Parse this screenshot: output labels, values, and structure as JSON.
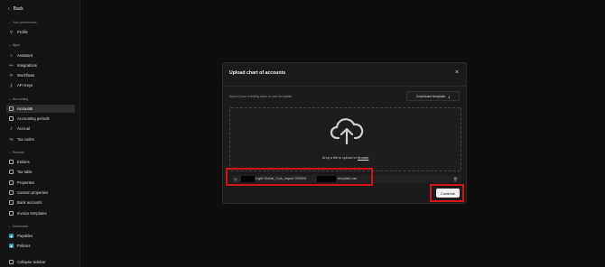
{
  "sidebar": {
    "back_label": "Back",
    "sections": {
      "preferences": "Your preferences",
      "apps": "Apps",
      "accounting": "Accounting",
      "records": "Records",
      "downloads": "Downloads"
    },
    "items": {
      "profile": "Profile",
      "assistant": "Assistant",
      "integrations": "Integrations",
      "workflows": "Workflows",
      "api_keys": "API Keys",
      "accounts": "Accounts",
      "accounting_periods": "Accounting periods",
      "accrual": "Accrual",
      "tax_codes": "Tax codes",
      "entities": "Entities",
      "tax_table": "Tax table",
      "properties": "Properties",
      "custom_properties": "Custom properties",
      "bank_accounts": "Bank accounts",
      "invoice_templates": "Invoice templates",
      "payables": "Payables",
      "policies": "Policies"
    },
    "collapse_label": "Collapse sidebar"
  },
  "modal": {
    "title": "Upload chart of accounts",
    "subtitle": "Import your existing data or use template",
    "download_label": "Download template",
    "drop_text": "Drop a file to upload or",
    "browse_label": "browse",
    "file_name_part1": "Light Global_CoA_import 250924",
    "file_name_part2": "template.csv",
    "continue_label": "Continue"
  },
  "colors": {
    "highlight": "#d9131a",
    "active_item": "#2e2e2e",
    "badge": "#2fa3a6"
  }
}
